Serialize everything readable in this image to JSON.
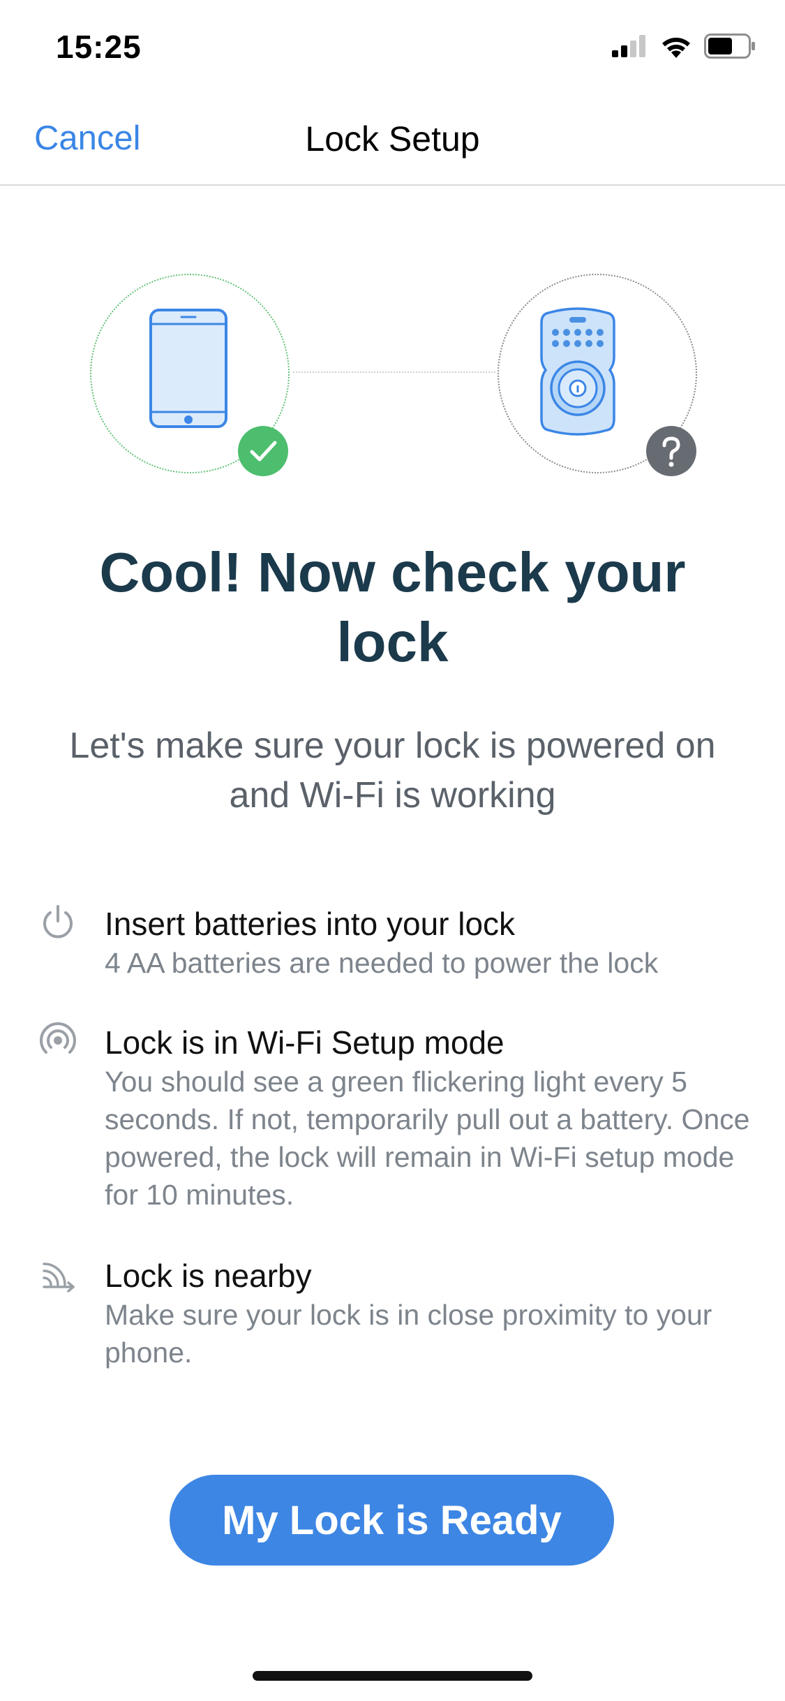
{
  "status": {
    "time": "15:25"
  },
  "nav": {
    "cancel_label": "Cancel",
    "title": "Lock Setup"
  },
  "main": {
    "headline": "Cool! Now check your lock",
    "subtitle": "Let's make sure your lock is powered on and Wi-Fi is working",
    "requirements": [
      {
        "icon": "power-icon",
        "title": "Insert batteries into your lock",
        "desc": "4 AA batteries are needed to power the lock"
      },
      {
        "icon": "wifi-setup-icon",
        "title": "Lock is in Wi-Fi Setup mode",
        "desc": "You should see a green flickering light every 5 seconds. If not, temporarily pull out a battery. Once powered, the lock will remain in Wi-Fi setup mode for 10 minutes."
      },
      {
        "icon": "nearby-signal-icon",
        "title": "Lock is nearby",
        "desc": "Make sure your lock is in close proximity to your phone."
      }
    ],
    "button_label": "My Lock is Ready"
  },
  "icons": {
    "phone": "phone-icon",
    "lock": "deadbolt-lock-icon",
    "success_badge": "check-icon",
    "unknown_badge": "question-icon"
  },
  "colors": {
    "accent": "#3d86e4",
    "heading": "#1b3a4c",
    "success": "#4cbe6d",
    "unknown": "#676b72"
  }
}
